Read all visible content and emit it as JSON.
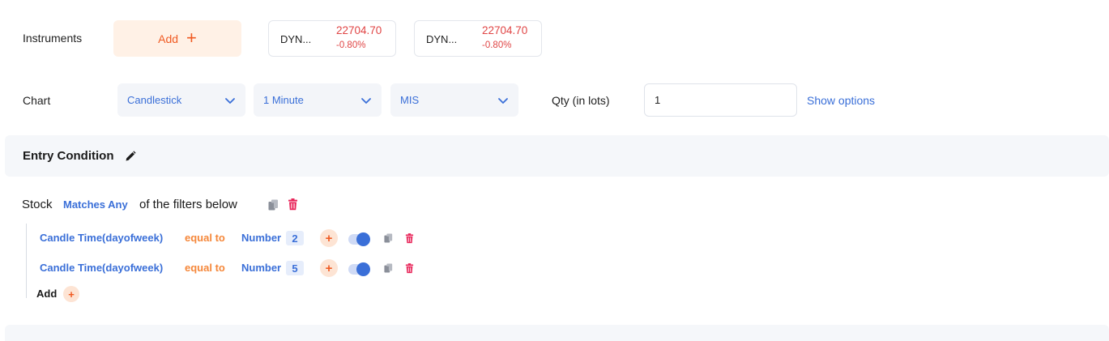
{
  "instruments": {
    "label": "Instruments",
    "add_label": "Add",
    "add_icon": "plus-icon",
    "items": [
      {
        "name": "DYN...",
        "price": "22704.70",
        "change": "-0.80%"
      },
      {
        "name": "DYN...",
        "price": "22704.70",
        "change": "-0.80%"
      }
    ]
  },
  "chart": {
    "label": "Chart",
    "type_value": "Candlestick",
    "interval_value": "1 Minute",
    "product_value": "MIS",
    "qty_label": "Qty (in lots)",
    "qty_value": "1",
    "show_options_label": "Show options"
  },
  "entry": {
    "title": "Entry Condition",
    "edit_icon": "pencil-icon",
    "group": {
      "subject": "Stock",
      "match_mode": "Matches Any",
      "suffix": "of the filters below"
    },
    "conditions": [
      {
        "field": "Candle Time(dayofweek)",
        "operator": "equal to",
        "value_type": "Number",
        "value": "2",
        "enabled": true
      },
      {
        "field": "Candle Time(dayofweek)",
        "operator": "equal to",
        "value_type": "Number",
        "value": "5",
        "enabled": true
      }
    ],
    "add_label": "Add"
  },
  "colors": {
    "accent_orange": "#f05a22",
    "accent_blue": "#3a6fd8",
    "negative_red": "#e04545",
    "delete_pink": "#e8265a"
  }
}
